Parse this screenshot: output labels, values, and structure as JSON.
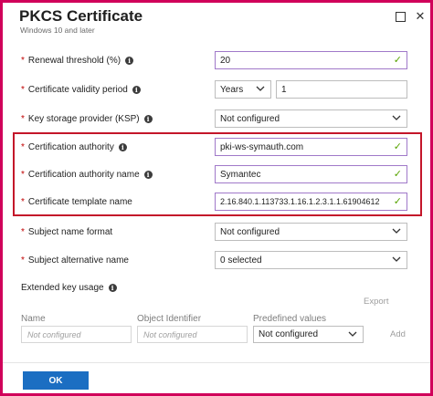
{
  "window": {
    "title": "PKCS Certificate",
    "subtitle": "Windows 10 and later",
    "maximize_icon": "maximize-icon",
    "close_icon": "close-icon",
    "close_glyph": "✕"
  },
  "form": {
    "renewal_threshold": {
      "label": "Renewal threshold (%)",
      "value": "20"
    },
    "validity_period": {
      "label": "Certificate validity period",
      "unit": "Years",
      "value": "1"
    },
    "ksp": {
      "label": "Key storage provider (KSP)",
      "value": "Not configured"
    },
    "ca": {
      "label": "Certification authority",
      "value": "pki-ws-symauth.com"
    },
    "ca_name": {
      "label": "Certification authority name",
      "value": "Symantec"
    },
    "template": {
      "label": "Certificate template name",
      "value": "2.16.840.1.113733.1.16.1.2.3.1.1.61904612"
    },
    "subject_format": {
      "label": "Subject name format",
      "value": "Not configured"
    },
    "san": {
      "label": "Subject alternative name",
      "value": "0 selected"
    }
  },
  "eku": {
    "label": "Extended key usage",
    "export_label": "Export",
    "col_name": "Name",
    "col_oid": "Object Identifier",
    "col_predefined": "Predefined values",
    "name_placeholder": "Not configured",
    "oid_placeholder": "Not configured",
    "predefined_value": "Not configured",
    "add_label": "Add"
  },
  "footer": {
    "ok_label": "OK"
  },
  "symbols": {
    "required": "*",
    "info": "i",
    "check": "✓"
  },
  "colors": {
    "accent": "#1b6ec2",
    "valid": "#57a300",
    "highlight": "#c4162a",
    "frame": "#d0005a"
  }
}
